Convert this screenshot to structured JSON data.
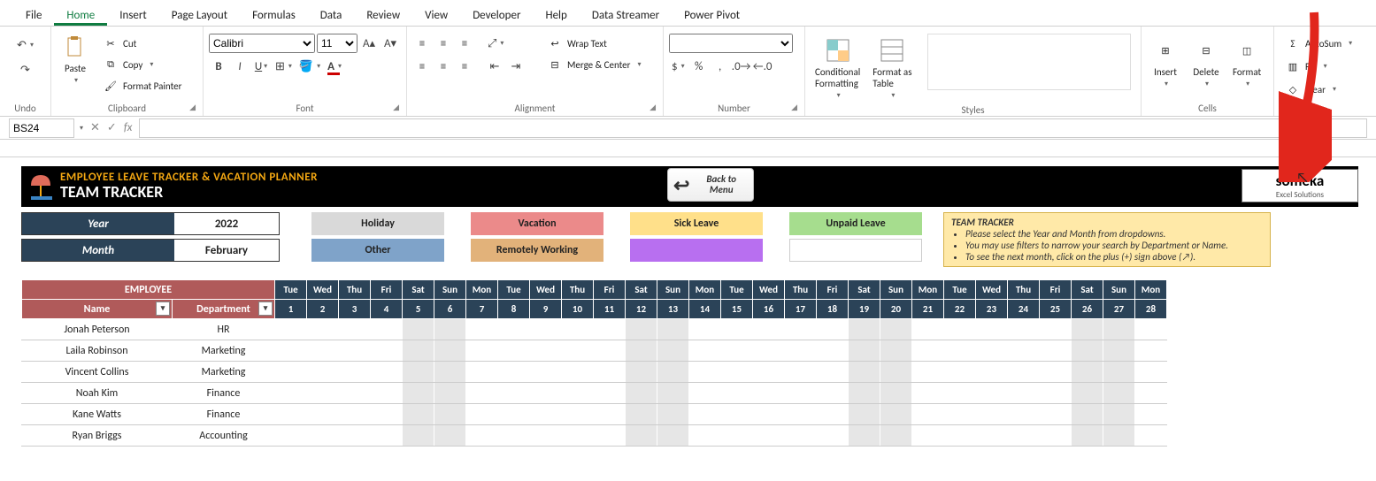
{
  "ribbon": {
    "tabs": [
      "File",
      "Home",
      "Insert",
      "Page Layout",
      "Formulas",
      "Data",
      "Review",
      "View",
      "Developer",
      "Help",
      "Data Streamer",
      "Power Pivot"
    ],
    "active_tab": "Home",
    "groups": {
      "undo": {
        "label": "Undo"
      },
      "clipboard": {
        "label": "Clipboard",
        "paste": "Paste",
        "cut": "Cut",
        "copy": "Copy",
        "fmtpainter": "Format Painter"
      },
      "font": {
        "label": "Font",
        "name": "Calibri",
        "size": "11"
      },
      "alignment": {
        "label": "Alignment",
        "wrap": "Wrap Text",
        "merge": "Merge & Center"
      },
      "number": {
        "label": "Number"
      },
      "styles": {
        "label": "Styles",
        "cond": "Conditional\nFormatting",
        "fat": "Format as\nTable"
      },
      "cells": {
        "label": "Cells",
        "insert": "Insert",
        "delete": "Delete",
        "format": "Format"
      },
      "editing": {
        "autosum": "AutoSum",
        "fill": "Fill",
        "clear": "Clear"
      }
    }
  },
  "formula_bar": {
    "cell_ref": "BS24",
    "formula": ""
  },
  "banner": {
    "top": "EMPLOYEE LEAVE TRACKER & VACATION PLANNER",
    "sub": "TEAM TRACKER",
    "back": "Back to Menu",
    "brand": "someka",
    "brand_sub": "Excel Solutions"
  },
  "controls": {
    "year_label": "Year",
    "year_value": "2022",
    "month_label": "Month",
    "month_value": "February"
  },
  "legend": {
    "holiday": "Holiday",
    "vacation": "Vacation",
    "sick": "Sick Leave",
    "unpaid": "Unpaid Leave",
    "other": "Other",
    "remote": "Remotely Working"
  },
  "tips": {
    "title": "TEAM TRACKER",
    "l1": "Please select the Year and Month from dropdowns.",
    "l2": "You may use filters to narrow your search by Department or Name.",
    "l3": "To see the next month, click on the plus (+) sign above (↗)."
  },
  "grid": {
    "emp_header": "EMPLOYEE",
    "name_header": "Name",
    "dept_header": "Department",
    "weekdays": [
      "Tue",
      "Wed",
      "Thu",
      "Fri",
      "Sat",
      "Sun",
      "Mon",
      "Tue",
      "Wed",
      "Thu",
      "Fri",
      "Sat",
      "Sun",
      "Mon",
      "Tue",
      "Wed",
      "Thu",
      "Fri",
      "Sat",
      "Sun",
      "Mon",
      "Tue",
      "Wed",
      "Thu",
      "Fri",
      "Sat",
      "Sun",
      "Mon"
    ],
    "days": [
      "1",
      "2",
      "3",
      "4",
      "5",
      "6",
      "7",
      "8",
      "9",
      "10",
      "11",
      "12",
      "13",
      "14",
      "15",
      "16",
      "17",
      "18",
      "19",
      "20",
      "21",
      "22",
      "23",
      "24",
      "25",
      "26",
      "27",
      "28"
    ],
    "weekend_idx": [
      4,
      5,
      11,
      12,
      18,
      19,
      25,
      26
    ],
    "rows": [
      {
        "name": "Jonah Peterson",
        "dept": "HR"
      },
      {
        "name": "Laila Robinson",
        "dept": "Marketing"
      },
      {
        "name": "Vincent Collins",
        "dept": "Marketing"
      },
      {
        "name": "Noah Kim",
        "dept": "Finance"
      },
      {
        "name": "Kane Watts",
        "dept": "Finance"
      },
      {
        "name": "Ryan Briggs",
        "dept": "Accounting"
      }
    ]
  }
}
